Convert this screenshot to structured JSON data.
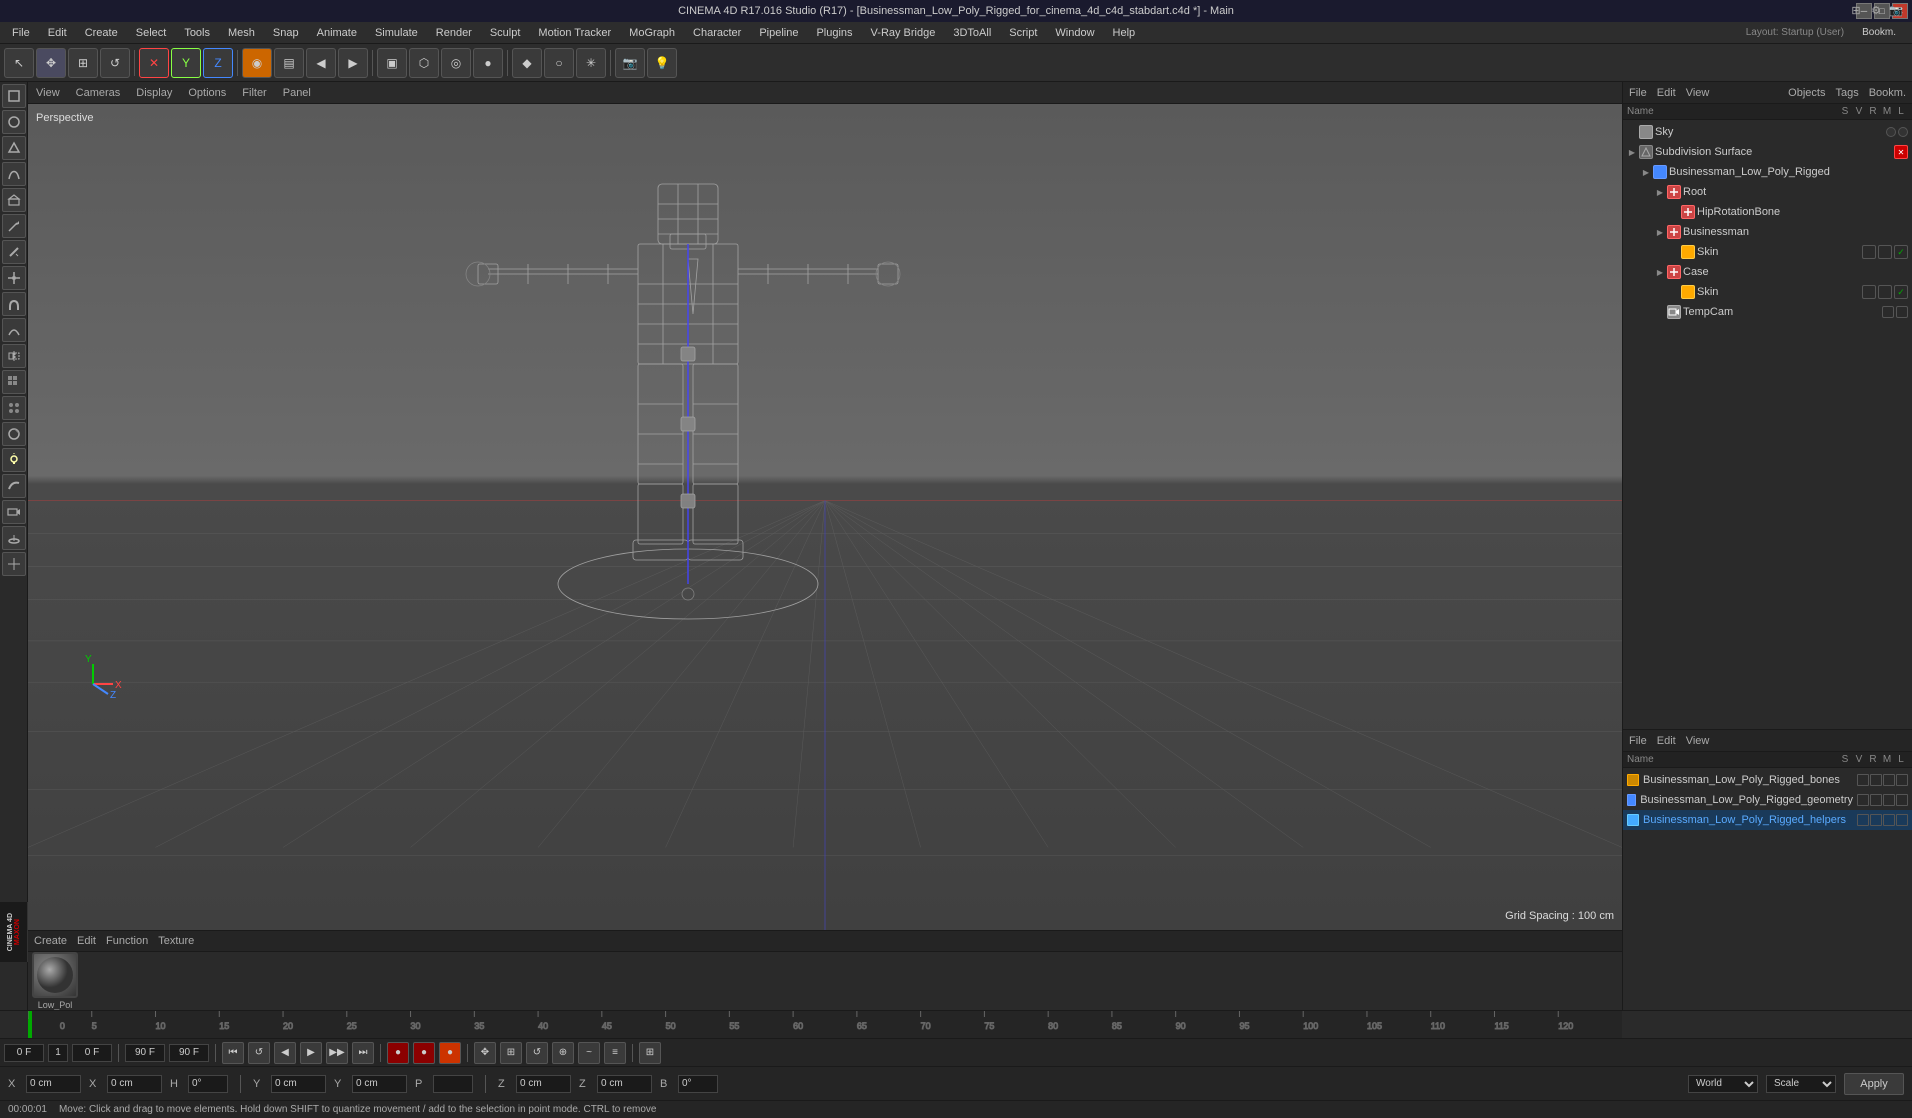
{
  "titlebar": {
    "title": "CINEMA 4D R17.016 Studio (R17) - [Businessman_Low_Poly_Rigged_for_cinema_4d_c4d_stabdart.c4d *] - Main",
    "minimize_label": "─",
    "maximize_label": "□",
    "close_label": "✕"
  },
  "menubar": {
    "items": [
      "File",
      "Edit",
      "Create",
      "Select",
      "Tools",
      "Mesh",
      "Snap",
      "Animate",
      "Simulate",
      "Render",
      "Sculpt",
      "Motion Tracker",
      "MoGraph",
      "Character",
      "Pipeline",
      "Plugins",
      "V-Ray Bridge",
      "3DToAll",
      "Script",
      "Window",
      "Help"
    ]
  },
  "toolbar": {
    "buttons": [
      "✦",
      "+",
      "✥",
      "↺",
      "✕",
      "Y",
      "Z",
      "◉",
      "▤",
      "◀",
      "▶",
      "▣",
      "⬡",
      "◎",
      "●",
      "◆",
      "○",
      "✳",
      "✦"
    ]
  },
  "layout": {
    "label": "Layout:",
    "value": "Startup (User)"
  },
  "viewport": {
    "perspective_label": "Perspective",
    "grid_spacing_label": "Grid Spacing : 100 cm",
    "header_items": [
      "View",
      "Cameras",
      "Display",
      "Options",
      "Filter",
      "Panel"
    ]
  },
  "object_manager": {
    "header_items": [
      "File",
      "Edit",
      "View"
    ],
    "bookmarks_label": "Bookm.",
    "tags_label": "Tags",
    "objects_label": "Objects",
    "column_headers": [
      "Name",
      "S",
      "V",
      "R",
      "M",
      "L"
    ],
    "items": [
      {
        "name": "Sky",
        "depth": 0,
        "has_arrow": false,
        "icon_color": "#cccccc",
        "tags": []
      },
      {
        "name": "Subdivision Surface",
        "depth": 0,
        "has_arrow": true,
        "icon_color": "#888888",
        "tags": [
          "red_x"
        ]
      },
      {
        "name": "Businessman_Low_Poly_Rigged",
        "depth": 1,
        "has_arrow": true,
        "icon_color": "#4488ff",
        "tags": []
      },
      {
        "name": "Root",
        "depth": 2,
        "has_arrow": true,
        "icon_color": "#ff4444",
        "tags": []
      },
      {
        "name": "HipRotationBone",
        "depth": 3,
        "has_arrow": false,
        "icon_color": "#ff4444",
        "tags": []
      },
      {
        "name": "Businessman",
        "depth": 2,
        "has_arrow": true,
        "icon_color": "#ff4444",
        "tags": []
      },
      {
        "name": "Skin",
        "depth": 3,
        "has_arrow": false,
        "icon_color": "#ffaa00",
        "tags": [
          "check"
        ]
      },
      {
        "name": "Case",
        "depth": 2,
        "has_arrow": true,
        "icon_color": "#ff4444",
        "tags": []
      },
      {
        "name": "Skin",
        "depth": 3,
        "has_arrow": false,
        "icon_color": "#ffaa00",
        "tags": [
          "check"
        ]
      },
      {
        "name": "TempCam",
        "depth": 2,
        "has_arrow": false,
        "icon_color": "#cccccc",
        "tags": []
      }
    ]
  },
  "material_manager": {
    "header_items": [
      "File",
      "Edit",
      "View"
    ],
    "column_headers": [
      "Name",
      "S",
      "V",
      "R",
      "M",
      "L"
    ],
    "items": [
      {
        "name": "Businessman_Low_Poly_Rigged_bones",
        "depth": 0,
        "icon_color": "#cc8800",
        "highlight": false
      },
      {
        "name": "Businessman_Low_Poly_Rigged_geometry",
        "depth": 0,
        "icon_color": "#4488ff",
        "highlight": false
      },
      {
        "name": "Businessman_Low_Poly_Rigged_helpers",
        "depth": 0,
        "icon_color": "#44aaff",
        "highlight": true
      }
    ]
  },
  "material_panel": {
    "header_items": [
      "Create",
      "Edit",
      "Function",
      "Texture"
    ],
    "thumbnail_label": "Low_Pol"
  },
  "timeline": {
    "ticks": [
      0,
      5,
      10,
      15,
      20,
      25,
      30,
      35,
      40,
      45,
      50,
      55,
      60,
      65,
      70,
      75,
      80,
      85,
      90,
      95,
      100,
      105,
      110,
      115,
      120
    ],
    "current_frame": "0",
    "frame_label": "0 F",
    "end_frame": "90 F",
    "end_frame2": "90 F"
  },
  "transport": {
    "frame_input": "0 F",
    "fps_label": "1",
    "fps_input": "0 F",
    "frame_range_1": "90 F",
    "frame_range_2": "90 F",
    "buttons": [
      "⏮",
      "↺",
      "◀",
      "▶",
      "▶▶",
      "⏭"
    ]
  },
  "coordinates": {
    "x_label": "X",
    "y_label": "Y",
    "z_label": "Z",
    "x_value": "0 cm",
    "y_value": "0 cm",
    "z_value": "0 cm",
    "x2_label": "X",
    "y2_label": "Y",
    "z2_label": "Z",
    "x2_value": "0 cm",
    "y2_value": "0 cm",
    "z2_value": "0 cm",
    "h_label": "H",
    "p_label": "P",
    "b_label": "B",
    "h_value": "0°",
    "p_value": "",
    "b_value": "0°",
    "world_dropdown": "World",
    "scale_dropdown": "Scale",
    "apply_label": "Apply"
  },
  "status_bar": {
    "time": "00:00:01",
    "message": "Move: Click and drag to move elements. Hold down SHIFT to quantize movement / add to the selection in point mode. CTRL to remove"
  }
}
